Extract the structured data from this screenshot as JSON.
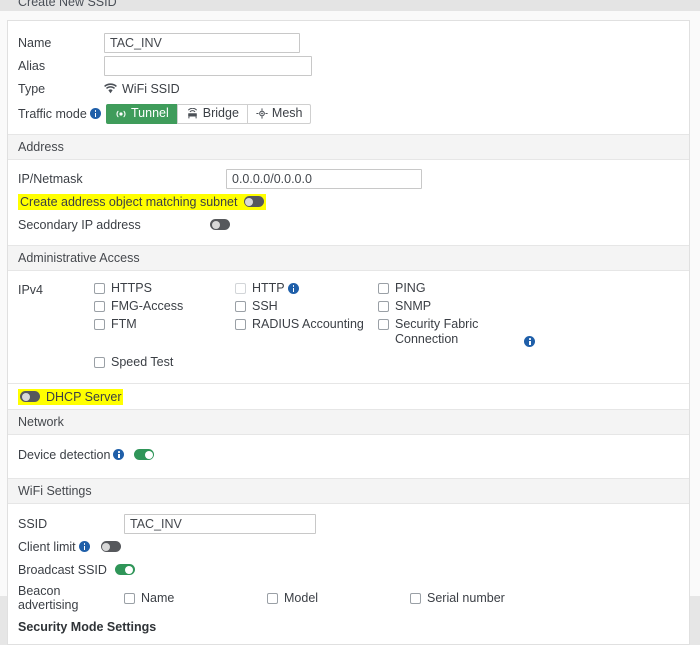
{
  "dialog": {
    "title": "Create New SSID"
  },
  "basic": {
    "name_label": "Name",
    "name_value": "TAC_INV",
    "alias_label": "Alias",
    "alias_value": "",
    "alias_placeholder": "",
    "type_label": "Type",
    "type_value": "WiFi SSID",
    "type_icon": "wifi-icon",
    "traffic_mode_label": "Traffic mode",
    "traffic_mode_info_icon": "info-icon",
    "traffic_modes": [
      {
        "label": "Tunnel",
        "icon": "tunnel-icon",
        "selected": true
      },
      {
        "label": "Bridge",
        "icon": "access-point-icon",
        "selected": false
      },
      {
        "label": "Mesh",
        "icon": "mesh-icon",
        "selected": false
      }
    ]
  },
  "address": {
    "section_title": "Address",
    "ipmask_label": "IP/Netmask",
    "ipmask_value": "0.0.0.0/0.0.0.0",
    "create_addr_obj_label": "Create address object matching subnet",
    "create_addr_obj_state": "off",
    "create_addr_obj_highlighted": true,
    "secondary_ip_label": "Secondary IP address",
    "secondary_ip_state": "off"
  },
  "admin_access": {
    "section_title": "Administrative Access",
    "ipv4_label": "IPv4",
    "columns": [
      [
        {
          "label": "HTTPS",
          "checked": false,
          "faint": false,
          "info": false
        },
        {
          "label": "FMG-Access",
          "checked": false,
          "faint": false,
          "info": false
        },
        {
          "label": "FTM",
          "checked": false,
          "faint": false,
          "info": false
        }
      ],
      [
        {
          "label": "HTTP",
          "checked": false,
          "faint": true,
          "info": true
        },
        {
          "label": "SSH",
          "checked": false,
          "faint": false,
          "info": false
        },
        {
          "label": "RADIUS Accounting",
          "checked": false,
          "faint": false,
          "info": false
        }
      ],
      [
        {
          "label": "PING",
          "checked": false,
          "faint": false,
          "info": false
        },
        {
          "label": "SNMP",
          "checked": false,
          "faint": false,
          "info": false
        },
        {
          "label": "Security Fabric Connection",
          "checked": false,
          "faint": false,
          "info": true
        }
      ]
    ],
    "speed_test": {
      "label": "Speed Test",
      "checked": false
    }
  },
  "dhcp": {
    "label": "DHCP Server",
    "state": "off",
    "highlighted": true
  },
  "network": {
    "section_title": "Network",
    "device_detection_label": "Device detection",
    "device_detection_state": "on"
  },
  "wifi": {
    "section_title": "WiFi Settings",
    "ssid_label": "SSID",
    "ssid_value": "TAC_INV",
    "client_limit_label": "Client limit",
    "client_limit_state": "off",
    "broadcast_ssid_label": "Broadcast SSID",
    "broadcast_ssid_state": "on",
    "beacon_label": "Beacon advertising",
    "beacon_options": [
      {
        "label": "Name",
        "checked": false
      },
      {
        "label": "Model",
        "checked": false
      },
      {
        "label": "Serial number",
        "checked": false
      }
    ]
  },
  "security": {
    "heading": "Security Mode Settings"
  },
  "colors": {
    "accent_green": "#3f9c5b",
    "toggle_on": "#2f9558",
    "toggle_off": "#56585c",
    "info_blue": "#1f5fa9",
    "highlight_yellow": "#ffff00",
    "section_header_bg": "#f4f4f4"
  }
}
